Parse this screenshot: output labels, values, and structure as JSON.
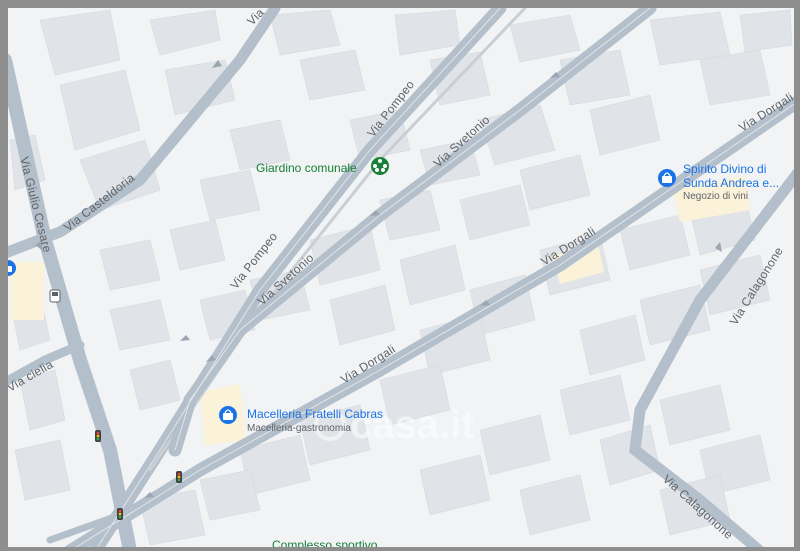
{
  "colors": {
    "background": "#f1f3f4",
    "building": "#e0e3e7",
    "road": "#b3bfca",
    "road_edge": "#ffffff",
    "shop_accent": "#1a73e8",
    "park_accent": "#188038",
    "highlight_lot": "#fbf2da"
  },
  "streets": {
    "via_giulio_cesare": "Via Giulio Cesare",
    "via_casteldoria": "Via Casteldoria",
    "via_pompeo_top": "Via Pompeo",
    "via_pompeo_bottom": "Via Pompeo",
    "via_svetonio_top": "Via Svetonio",
    "via_svetonio_bottom": "Via Svetonio",
    "via_dorgali_right": "Via Dorgali",
    "via_dorgali_mid": "Via Dorgali",
    "via_dorgali_low": "Via Dorgali",
    "via_calagonone_upper": "Via Calagonone",
    "via_calagonone_lower": "Via Calagonone",
    "via_cielia": "Via cielia",
    "via_top": "Via"
  },
  "pois": {
    "park": {
      "title": "Giardino comunale",
      "icon": "park-icon"
    },
    "wine_shop": {
      "title_line1": "Spirito Divino di",
      "title_line2": "Sunda Andrea e...",
      "subtitle": "Negozio di vini",
      "icon": "shopping-bag-icon"
    },
    "butcher": {
      "title": "Macelleria Fratelli Cabras",
      "subtitle": "Macelleria-gastronomia",
      "icon": "shopping-bag-icon"
    },
    "sports": {
      "title": "Complesso sportivo",
      "icon": "sports-icon"
    }
  },
  "watermark": {
    "text": "casa.it"
  },
  "traffic_light_icon": "traffic-light-icon",
  "bus_stop_icon": "bus-stop-icon"
}
